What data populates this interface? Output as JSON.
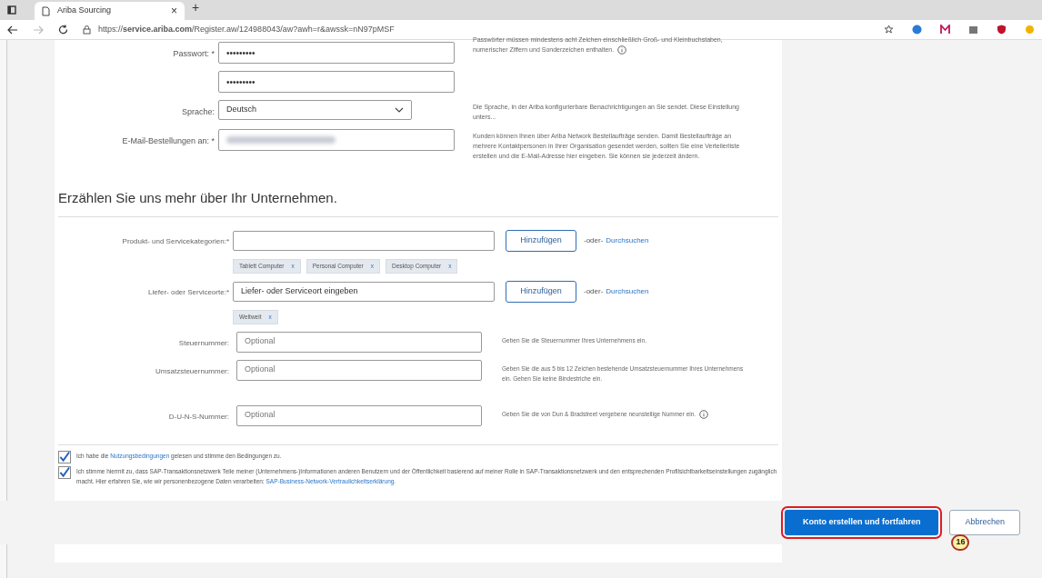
{
  "browser": {
    "tab_title": "Ariba Sourcing",
    "tab_close": "×",
    "new_tab": "+",
    "url": "https://**service.ariba.com**/Register.aw/124988043/aw?awh=r&awssk=nN97pMSF"
  },
  "account_fields": [
    {
      "kind": "password",
      "label": "Passwort: *",
      "value": "•••••••••",
      "help": "Passwörter müssen mindestens acht Zeichen einschließlich Groß- und Kleinbuchstaben, numerischer Ziffern und Sonderzeichen enthalten.",
      "info": true
    },
    {
      "kind": "password",
      "value": "•••••••••"
    },
    {
      "kind": "select",
      "label": "Sprache:",
      "value": "Deutsch",
      "help": "Die Sprache, in der Ariba konfigurierbare Benachrichtigungen an Sie sendet. Diese Einstellung unters..."
    },
    {
      "kind": "blurred",
      "label": "E-Mail-Bestellungen an: *",
      "help": "Kunden können Ihnen über Ariba Network Bestellaufträge senden. Damit Bestellaufträge an mehrere Kontaktpersonen in Ihrer Organisation gesendet werden, sollten Sie eine Verteilerliste erstellen und die E-Mail-Adresse hier eingeben. Sie können sie jederzeit ändern."
    }
  ],
  "section_heading": "Erzählen Sie uns mehr über Ihr Unternehmen.",
  "company_fields": [
    {
      "kind": "picker",
      "label": "Produkt- und Servicekategorien:*",
      "button": "Hinzufügen",
      "or_text": "-oder-",
      "link": "Durchsuchen",
      "chips": [
        {
          "label": "Tablett Computer",
          "remove": "x"
        },
        {
          "label": "Personal Computer",
          "remove": "x"
        },
        {
          "label": "Desktop Computer",
          "remove": "x"
        }
      ]
    },
    {
      "kind": "picker",
      "label": "Liefer- oder Serviceorte:*",
      "value": "Liefer- oder Serviceort eingeben",
      "button": "Hinzufügen",
      "or_text": "-oder-",
      "link": "Durchsuchen",
      "chips": [
        {
          "label": "Weltweit",
          "remove": "x"
        }
      ]
    },
    {
      "kind": "text",
      "label": "Steuernummer:",
      "placeholder": "Optional",
      "help": "Geben Sie die Steuernummer Ihres Unternehmens ein."
    },
    {
      "kind": "text",
      "label": "Umsatzsteuernummer:",
      "placeholder": "Optional",
      "help": "Geben Sie die aus 5 bis 12 Zeichen bestehende Umsatzsteuernummer Ihres Unternehmens ein. Geben Sie keine Bindestriche ein."
    },
    {
      "kind": "text",
      "label": "D-U-N-S-Nummer:",
      "placeholder": "Optional",
      "help": "Geben Sie die von Dun & Bradstreet vergebene neunstellige Nummer ein.",
      "info": true
    }
  ],
  "agreements": [
    {
      "checked": true,
      "before": "Ich habe die",
      "link": "Nutzungsbedingungen",
      "after": "gelesen und stimme den Bedingungen zu."
    },
    {
      "checked": true,
      "before": "Ich stimme hiermit zu, dass SAP-Transaktionsnetzwerk Teile meiner (Unternehmens-)Informationen anderen Benutzern und der Öffentlichkeit basierend auf meiner Rolle in SAP-Transaktionsnetzwerk und den entsprechenden Profilsichtbarkeitseinstellungen zugänglich macht. Hier erfahren Sie, wie wir personenbezogene Daten verarbeiten:",
      "link": "SAP-Business-Network-Vertraulichkeitserklärung."
    }
  ],
  "footer": {
    "primary_button": "Konto erstellen und fortfahren",
    "secondary_button": "Abbrechen",
    "callout": "16"
  }
}
